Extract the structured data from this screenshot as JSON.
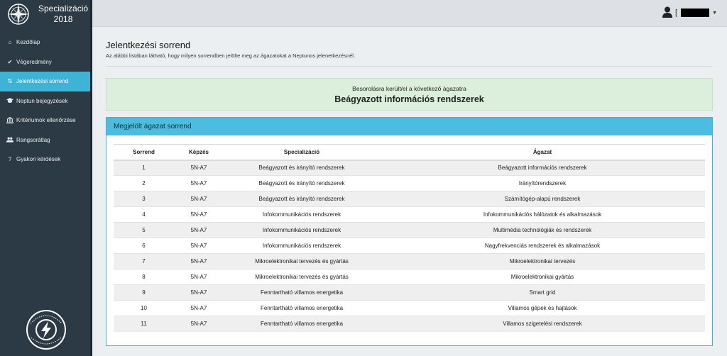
{
  "app": {
    "brand_line1": "Specializáció",
    "brand_line2": "2018"
  },
  "sidebar": {
    "items": [
      {
        "label": "Kezdőlap",
        "icon": "home-icon",
        "glyph": "⌂"
      },
      {
        "label": "Végeredmény",
        "icon": "check-icon",
        "glyph": "✔"
      },
      {
        "label": "Jelentkezési sorrend",
        "icon": "sort-icon",
        "glyph": "⇅",
        "active": true
      },
      {
        "label": "Neptun bejegyzések",
        "icon": "graduation-cap-icon",
        "glyph": "🎓"
      },
      {
        "label": "Kritériumok ellenőrzése",
        "icon": "institution-icon",
        "glyph": "🏛"
      },
      {
        "label": "Rangsorátlag",
        "icon": "users-icon",
        "glyph": "👥"
      },
      {
        "label": "Gyakori kérdések",
        "icon": "question-icon",
        "glyph": "?"
      }
    ]
  },
  "topbar": {
    "user_bracket": "["
  },
  "page": {
    "title": "Jelentkezési sorrend",
    "subtitle": "Az alábbi listában látható, hogy milyen sorrendben jelölte meg az ágazatokat a Neptunos jelenetkezésnél."
  },
  "alert": {
    "line1": "Besorolásra került/el a következő ágazatra",
    "line2": "Beágyazott információs rendszerek"
  },
  "panel": {
    "title": "Megjelölt ágazat sorrend",
    "columns": [
      "Sorrend",
      "Képzés",
      "Specializáció",
      "Ágazat"
    ],
    "rows": [
      [
        "1",
        "5N-A7",
        "Beágyazott és irányító rendszerek",
        "Beágyazott információs rendszerek"
      ],
      [
        "2",
        "5N-A7",
        "Beágyazott és irányító rendszerek",
        "Irányítórendszerek"
      ],
      [
        "3",
        "5N-A7",
        "Beágyazott és irányító rendszerek",
        "Számítógép-alapú rendszerek"
      ],
      [
        "4",
        "5N-A7",
        "Infokommunikációs rendszerek",
        "Infokommunikációs hálózatok és alkalmazások"
      ],
      [
        "5",
        "5N-A7",
        "Infokommunikációs rendszerek",
        "Multimédia technológiák és rendszerek"
      ],
      [
        "6",
        "5N-A7",
        "Infokommunikációs rendszerek",
        "Nagyfrekvenciás rendszerek és alkalmazások"
      ],
      [
        "7",
        "5N-A7",
        "Mikroelektronikai tervezés és gyártás",
        "Mikroelektronikai tervezés"
      ],
      [
        "8",
        "5N-A7",
        "Mikroelektronikai tervezés és gyártás",
        "Mikroelektronikai gyártás"
      ],
      [
        "9",
        "5N-A7",
        "Fenntartható villamos energetika",
        "Smart grid"
      ],
      [
        "10",
        "5N-A7",
        "Fenntartható villamos energetika",
        "Villamos gépek és hajtások"
      ],
      [
        "11",
        "5N-A7",
        "Fenntartható villamos energetika",
        "Villamos szigetelési rendszerek"
      ]
    ]
  },
  "colors": {
    "sidebar": "#2b3a44",
    "accent": "#3fb3d6",
    "alert_bg": "#dcefdc"
  },
  "footer_logo": {
    "text": "BME VILLAMOSMÉRNÖKI ÉS INFORMATIKAI KAR"
  }
}
